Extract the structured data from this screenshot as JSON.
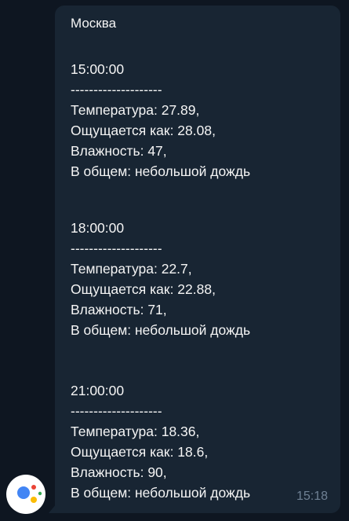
{
  "message": {
    "sender": "Москва",
    "time": "15:18",
    "forecasts": [
      {
        "time": "15:00:00",
        "divider": "--------------------",
        "temperature": "Температура: 27.89,",
        "feels_like": "Ощущается как: 28.08,",
        "humidity": "Влажность: 47,",
        "overall": "В общем: небольшой дождь"
      },
      {
        "time": "18:00:00",
        "divider": "--------------------",
        "temperature": "Температура: 22.7,",
        "feels_like": "Ощущается как: 22.88,",
        "humidity": "Влажность: 71,",
        "overall": "В общем: небольшой дождь"
      },
      {
        "time": "21:00:00",
        "divider": "--------------------",
        "temperature": "Температура: 18.36,",
        "feels_like": "Ощущается как: 18.6,",
        "humidity": "Влажность: 90,",
        "overall": "В общем: небольшой дождь"
      }
    ]
  },
  "avatar": {
    "icon": "google-assistant-icon",
    "colors": [
      "#4285f4",
      "#ea4335",
      "#fbbc05",
      "#34a853"
    ]
  },
  "colors": {
    "background": "#0e1621",
    "bubble": "#182533",
    "text": "#f5f5f5",
    "timestamp": "#6f8194"
  }
}
